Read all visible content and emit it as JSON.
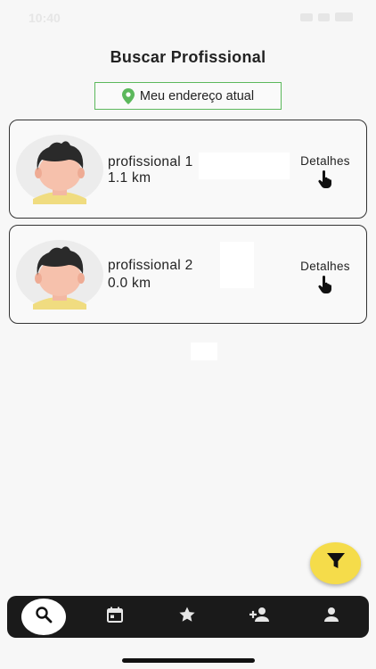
{
  "status_bar": {
    "time": "10:40"
  },
  "header": {
    "title": "Buscar Profissional"
  },
  "location_button": {
    "label": "Meu endereço atual",
    "icon": "map-pin-icon",
    "color": "#5cb85c"
  },
  "professionals": [
    {
      "name": "profissional  1",
      "distance": "1.1 km",
      "details_label": "Detalhes"
    },
    {
      "name": "profissional  2",
      "distance": "0.0 km",
      "details_label": "Detalhes"
    }
  ],
  "fab": {
    "icon": "filter-icon",
    "color": "#f5dc4a"
  },
  "bottom_nav": {
    "items": [
      {
        "icon": "search-icon",
        "active": true
      },
      {
        "icon": "calendar-icon",
        "active": false
      },
      {
        "icon": "star-icon",
        "active": false
      },
      {
        "icon": "add-person-icon",
        "active": false
      },
      {
        "icon": "person-icon",
        "active": false
      }
    ]
  }
}
